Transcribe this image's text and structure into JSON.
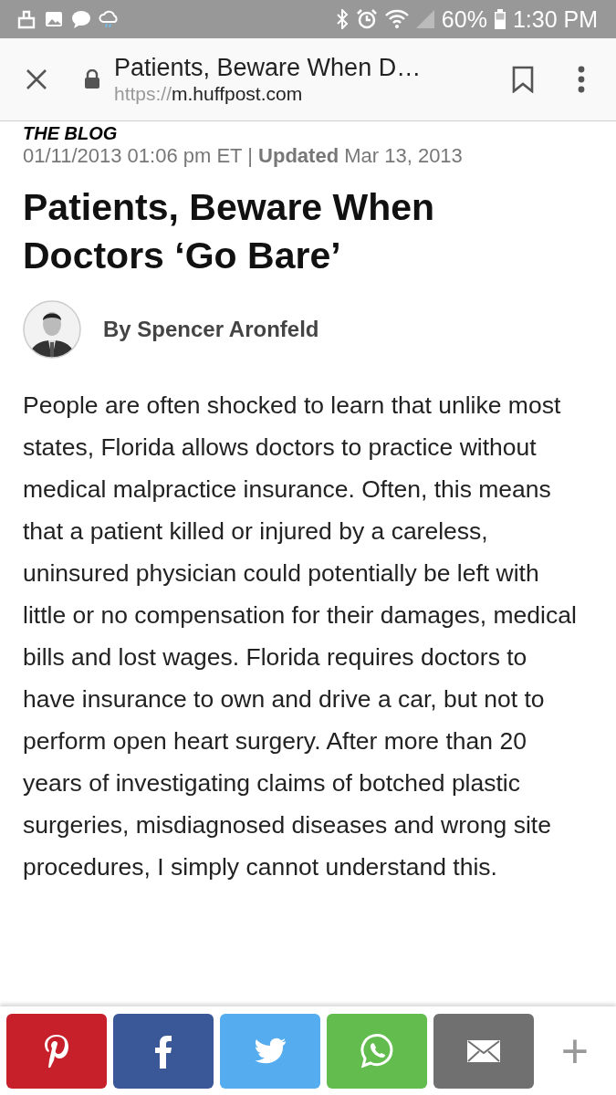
{
  "status_bar": {
    "battery": "60%",
    "time": "1:30 PM"
  },
  "browser_bar": {
    "title": "Patients, Beware When D…",
    "url_scheme": "https://",
    "url_host": "m.huffpost.com"
  },
  "article": {
    "section": "THE BLOG",
    "dateline": "01/11/2013 01:06 pm ET | **Updated** Mar 13, 2013",
    "headline": "Patients, Beware When Doctors ‘Go Bare’",
    "byline": "By Spencer Aronfeld",
    "body": "People are often shocked to learn that unlike most states, Florida allows doctors to practice without medical malpractice insurance. Often, this means that a patient killed or injured by a careless, uninsured physician could potentially be left with little or no compensation for their damages, medical bills and lost wages. Florida requires doctors to have insurance to own and drive a car, but not to perform open heart surgery. After more than 20 years of investigating claims of botched plastic surgeries, misdiagnosed diseases and wrong site procedures, I simply cannot understand this."
  },
  "share_bar": {
    "buttons": [
      {
        "kind": "pinterest",
        "color": "#c8202a"
      },
      {
        "kind": "facebook",
        "color": "#3a5897"
      },
      {
        "kind": "twitter",
        "color": "#55acee"
      },
      {
        "kind": "whatsapp",
        "color": "#62bd4e"
      },
      {
        "kind": "email",
        "color": "#707070"
      }
    ],
    "more": "+"
  }
}
